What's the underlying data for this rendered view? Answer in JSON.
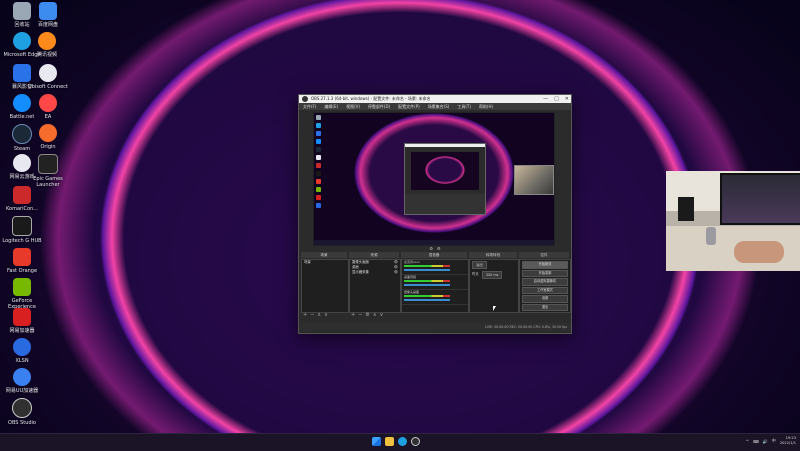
{
  "desktop": {
    "icons": [
      {
        "label": "回收站",
        "color": "#9aa7b5"
      },
      {
        "label": "百度网盘",
        "color": "#3c8cf0"
      },
      {
        "label": "Microsoft Edge",
        "color": "#1fa0e0"
      },
      {
        "label": "腾讯视频",
        "color": "#ff8a1c"
      },
      {
        "label": "暴风影音",
        "color": "#2a72e8"
      },
      {
        "label": "Ubisoft Connect",
        "color": "#e8e8f0"
      },
      {
        "label": "Battle.net",
        "color": "#148eff"
      },
      {
        "label": "EA",
        "color": "#ff4747"
      },
      {
        "label": "Steam",
        "color": "#1b2838"
      },
      {
        "label": "Origin",
        "color": "#f56c2d"
      },
      {
        "label": "网易云游戏",
        "color": "#e8e8f0"
      },
      {
        "label": "Epic Games Launcher",
        "color": "#222222"
      },
      {
        "label": "KomariCon...",
        "color": "#cc2a2a"
      },
      {
        "label": "Logitech G HUB",
        "color": "#1a1a1a"
      },
      {
        "label": "Fast Orange",
        "color": "#e83a2a"
      },
      {
        "label": "GeForce Experience",
        "color": "#76b900"
      },
      {
        "label": "网易加速器",
        "color": "#d92020"
      },
      {
        "label": "XLSN",
        "color": "#2a6ae0"
      },
      {
        "label": "网易UU加速器",
        "color": "#3a80f0"
      },
      {
        "label": "OBS Studio",
        "color": "#303030"
      }
    ]
  },
  "obs_window": {
    "title": "OBS 27.1.3 (64-bit, windows) - 配置文件: 未命名 - 场景: 未命名",
    "menu": [
      "文件(F)",
      "编辑(E)",
      "视图(V)",
      "停靠部件(D)",
      "配置文件(P)",
      "场景集合(S)",
      "工具(T)",
      "帮助(H)"
    ],
    "controls": {
      "minimize": "—",
      "maximize": "□",
      "close": "✕"
    },
    "source_toolbar": {
      "label": "",
      "icon_a": "⚙",
      "icon_b": "⚙"
    },
    "docks": {
      "scenes": {
        "header": "场景",
        "items": [
          "场景"
        ],
        "toolbar": [
          "+",
          "−",
          "∧",
          "∨"
        ]
      },
      "sources": {
        "header": "来源",
        "items": [
          {
            "name": "摄像头画面",
            "visible": "👁"
          },
          {
            "name": "桌面",
            "visible": "👁"
          },
          {
            "name": "显示器采集",
            "visible": "👁"
          }
        ],
        "toolbar": [
          "+",
          "−",
          "⚙",
          "∧",
          "∨"
        ]
      },
      "mixer": {
        "header": "混音器",
        "channels": [
          "麦克风/Aux",
          "桌面音频",
          "摄像头画面"
        ]
      },
      "transitions": {
        "header": "转场特效",
        "type": "淡出",
        "duration_label": "时长",
        "duration": "300 ms"
      },
      "controls": {
        "header": "控件",
        "buttons": [
          "开始推流",
          "开始录制",
          "启动虚拟摄像机",
          "工作室模式",
          "设置",
          "退出"
        ]
      }
    },
    "status": "LIVE: 00:00:00  REC: 00:00:00  CPU: 0.8%, 30.00 fps"
  },
  "taskbar": {
    "tray_icons": [
      "^",
      "⌨",
      "🔊",
      "中"
    ],
    "time": "19:23",
    "date": "2022/1/1"
  }
}
